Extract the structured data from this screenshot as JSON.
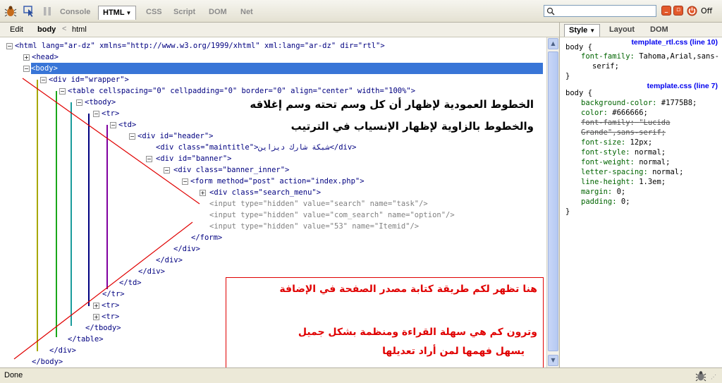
{
  "toolbar": {
    "tabs": [
      {
        "label": "Console",
        "active": false
      },
      {
        "label": "HTML",
        "active": true
      },
      {
        "label": "CSS",
        "active": false
      },
      {
        "label": "Script",
        "active": false
      },
      {
        "label": "DOM",
        "active": false
      },
      {
        "label": "Net",
        "active": false
      }
    ],
    "search_placeholder": "",
    "off_label": "Off",
    "icons": [
      "firebug-bug-icon",
      "inspect-icon",
      "pause-icon",
      "search-icon",
      "minimize-icon",
      "detach-icon",
      "close-icon"
    ]
  },
  "breadcrumb": {
    "edit": "Edit",
    "items": [
      "body",
      "html"
    ],
    "separator": "<"
  },
  "tree": {
    "lines": [
      {
        "t": "<html lang=\"ar-dz\" xmlns=\"http://www.w3.org/1999/xhtml\" xml:lang=\"ar-dz\" dir=\"rtl\">"
      },
      {
        "t": "<head>"
      },
      {
        "t": "<body>"
      },
      {
        "t": "<div id=\"wrapper\">"
      },
      {
        "t": "<table cellspacing=\"0\" cellpadding=\"0\" border=\"0\" align=\"center\" width=\"100%\">"
      },
      {
        "t": "<tbody>"
      },
      {
        "t": "<tr>"
      },
      {
        "t": "<td>"
      },
      {
        "t": "<div id=\"header\">"
      },
      {
        "t": "<div class=\"maintitle\">شبكة شارك ديزاين</div>"
      },
      {
        "t": "<div id=\"banner\">"
      },
      {
        "t": "<div class=\"banner_inner\">"
      },
      {
        "t": "<form method=\"post\" action=\"index.php\">"
      },
      {
        "t": "<div class=\"search_menu\">"
      },
      {
        "t": "<input type=\"hidden\" value=\"search\" name=\"task\"/>"
      },
      {
        "t": "<input type=\"hidden\" value=\"com_search\" name=\"option\"/>"
      },
      {
        "t": "<input type=\"hidden\" value=\"53\" name=\"Itemid\"/>"
      },
      {
        "t": "</form>"
      },
      {
        "t": "</div>"
      },
      {
        "t": "</div>"
      },
      {
        "t": "</div>"
      },
      {
        "t": "</td>"
      },
      {
        "t": "</tr>"
      },
      {
        "t": "<tr>"
      },
      {
        "t": "<tr>"
      },
      {
        "t": "</tbody>"
      },
      {
        "t": "</table>"
      },
      {
        "t": "</div>"
      },
      {
        "t": "</body>"
      }
    ]
  },
  "annotations": {
    "vertical_note_line1": "الخطوط العمودية لإظهار أن كل وسم تحته وسم إغلاقه",
    "vertical_note_line2": "والخطوط بالزاوية لإظهار الإنسياب في الترتيب",
    "callout_line1": "هنا تظهر لكم طريقة كتابة مصدر الصفحة في الإضافة",
    "callout_line2": "وترون كم هي سهلة القراءة ومنظمة بشكل جميل",
    "callout_line3": "يسهل فهمها لمن أراد تعديلها",
    "vline_colors": [
      "#a8a800",
      "#1aa81a",
      "#1a9c9c",
      "#000080",
      "#8000a0"
    ],
    "diag_color": "#e00000",
    "text_color": "#000000",
    "callout_color": "#e00000"
  },
  "side_panel": {
    "tabs": [
      {
        "label": "Style",
        "active": true
      },
      {
        "label": "Layout",
        "active": false
      },
      {
        "label": "DOM",
        "active": false
      }
    ],
    "rules": [
      {
        "source": "template_rtl.css (line 10)",
        "selector": "body {",
        "props": [
          {
            "name": "font-family:",
            "value": "Tahoma,Arial,sans-",
            "overridden": false
          },
          {
            "name": "",
            "value": "serif;",
            "overridden": false
          }
        ]
      },
      {
        "source": "template.css (line 7)",
        "selector": "body {",
        "props": [
          {
            "name": "background-color:",
            "value": "#1775B8;",
            "overridden": false
          },
          {
            "name": "color:",
            "value": "#666666;",
            "overridden": false
          },
          {
            "name": "font-family:",
            "value": "\"Lucida",
            "overridden": true
          },
          {
            "name": "",
            "value": "Grande\",sans-serif;",
            "overridden": true
          },
          {
            "name": "font-size:",
            "value": "12px;",
            "overridden": false
          },
          {
            "name": "font-style:",
            "value": "normal;",
            "overridden": false
          },
          {
            "name": "font-weight:",
            "value": "normal;",
            "overridden": false
          },
          {
            "name": "letter-spacing:",
            "value": "normal;",
            "overridden": false
          },
          {
            "name": "line-height:",
            "value": "1.3em;",
            "overridden": false
          },
          {
            "name": "margin:",
            "value": "0;",
            "overridden": false
          },
          {
            "name": "padding:",
            "value": "0;",
            "overridden": false
          }
        ]
      }
    ],
    "closing": "}"
  },
  "status": {
    "text": "Done"
  }
}
